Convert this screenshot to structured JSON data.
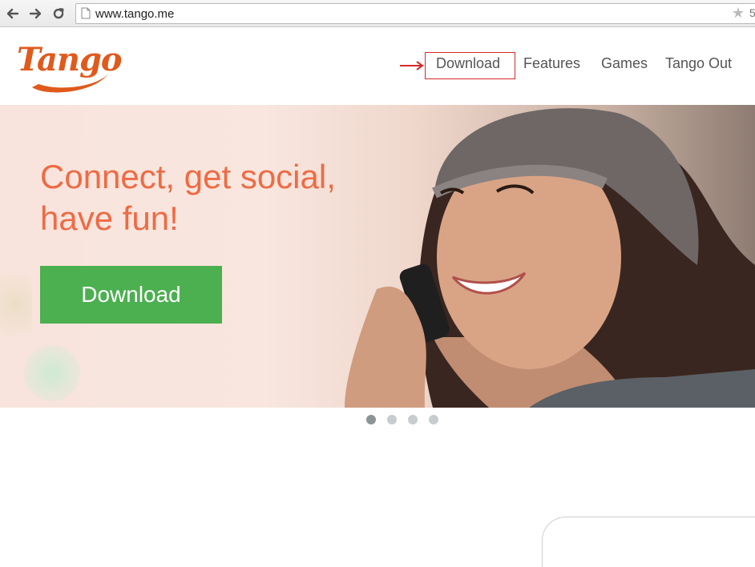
{
  "browser": {
    "back_icon": "arrow-left-icon",
    "forward_icon": "arrow-right-icon",
    "reload_icon": "reload-icon",
    "url": "www.tango.me",
    "bookmark_icon": "star-icon"
  },
  "site": {
    "logo_text": "Tango",
    "nav": [
      {
        "label": "Download"
      },
      {
        "label": "Features"
      },
      {
        "label": "Games"
      },
      {
        "label": "Tango Out"
      }
    ]
  },
  "hero": {
    "headline_line1": "Connect, get social,",
    "headline_line2": "have fun!",
    "cta_label": "Download",
    "slides_total": 4,
    "active_slide": 1
  },
  "colors": {
    "brand_orange": "#e05a1c",
    "headline": "#ee6b45",
    "cta_green": "#4caf50",
    "annotation_red": "#d62a2a"
  }
}
